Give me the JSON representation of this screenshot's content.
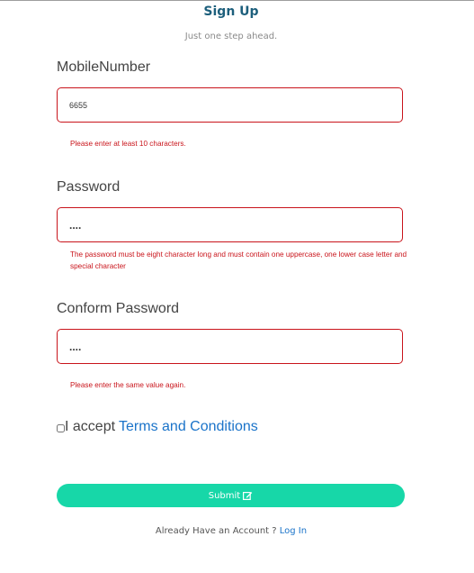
{
  "header": {
    "title": "Sign Up",
    "subtitle": "Just one step ahead."
  },
  "form": {
    "mobile": {
      "label": "MobileNumber",
      "value": "6655",
      "error": "Please enter at least 10 characters."
    },
    "password": {
      "label": "Password",
      "value": "....",
      "error": "The password must be eight character long and must contain one uppercase, one lower case letter and special character"
    },
    "confirm_password": {
      "label": "Conform Password",
      "value": "....",
      "error": "Please enter the same value again."
    },
    "accept": {
      "prefix": "I accept",
      "link_label": "Terms and Conditions",
      "checked": false
    },
    "submit_label": "Submit",
    "submit_icon": "edit-icon"
  },
  "footer": {
    "text": "Already Have an Account ?",
    "link_label": "Log In"
  },
  "colors": {
    "title": "#1d5f7c",
    "error": "#c9141b",
    "submit_bg": "#17d7a8",
    "link": "#1a73c9"
  }
}
